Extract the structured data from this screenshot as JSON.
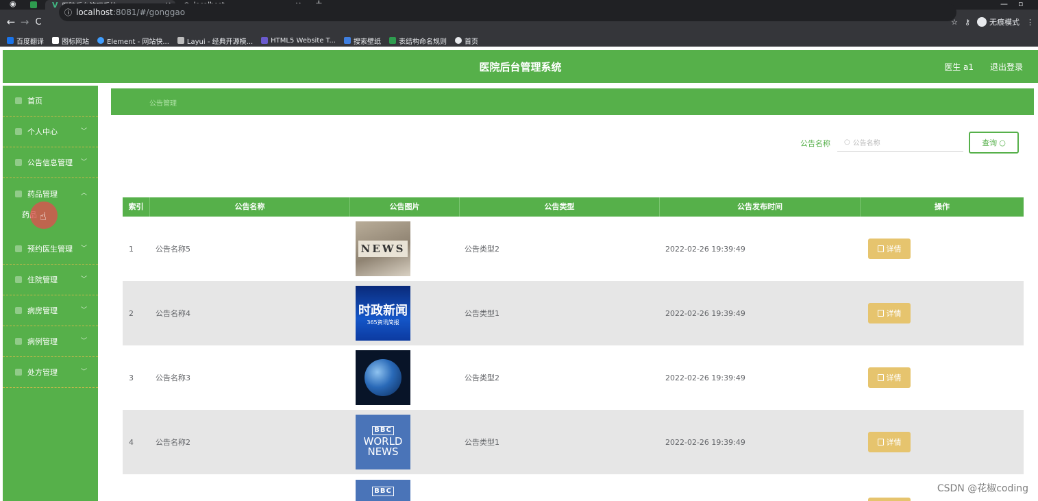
{
  "browser": {
    "tabs": [
      {
        "title": "医院后台管理系统",
        "active": true
      },
      {
        "title": "localhost",
        "active": false
      }
    ],
    "url_host": "localhost",
    "url_rest": ":8081/#/gonggao",
    "incognito_label": "无痕模式",
    "bookmarks": [
      {
        "label": "百度翻译",
        "icon": "translate-icon",
        "color": "#1a73e8"
      },
      {
        "label": "图标网站",
        "icon": "flag-icon",
        "color": "#ffffff"
      },
      {
        "label": "Element - 网站快...",
        "icon": "element-icon",
        "color": "#409eff"
      },
      {
        "label": "Layui - 经典开源模...",
        "icon": "layui-icon",
        "color": "#bdbdbd"
      },
      {
        "label": "HTML5 Website T...",
        "icon": "html5-icon",
        "color": "#6a5acd"
      },
      {
        "label": "搜索壁纸",
        "icon": "wallpaper-icon",
        "color": "#3f7fe0"
      },
      {
        "label": "表结构命名规则",
        "icon": "doc-icon",
        "color": "#2e9c4f"
      },
      {
        "label": "首页",
        "icon": "globe-icon",
        "color": "#e8eaed"
      }
    ]
  },
  "header": {
    "title": "医院后台管理系统",
    "user": "医生 a1",
    "logout": "退出登录"
  },
  "sidebar": {
    "items": [
      {
        "label": "首页",
        "has_chevron": false
      },
      {
        "label": "个人中心",
        "has_chevron": true
      },
      {
        "label": "公告信息管理",
        "has_chevron": true
      },
      {
        "label": "药品管理",
        "has_chevron": true,
        "expanded": true
      },
      {
        "label": "预约医生管理",
        "has_chevron": true
      },
      {
        "label": "住院管理",
        "has_chevron": true
      },
      {
        "label": "病房管理",
        "has_chevron": true
      },
      {
        "label": "病例管理",
        "has_chevron": true
      },
      {
        "label": "处方管理",
        "has_chevron": true
      }
    ],
    "submenu_label": "药品"
  },
  "breadcrumb": {
    "text": "公告管理"
  },
  "search": {
    "label": "公告名称",
    "placeholder": "公告名称",
    "button": "查询"
  },
  "table": {
    "headers": [
      "索引",
      "公告名称",
      "公告图片",
      "公告类型",
      "公告发布时间",
      "操作"
    ],
    "rows": [
      {
        "index": "1",
        "name": "公告名称5",
        "image": "news-blocks",
        "type": "公告类型2",
        "time": "2022-02-26 19:39:49",
        "action": "详情"
      },
      {
        "index": "2",
        "name": "公告名称4",
        "image": "shizheng",
        "type": "公告类型1",
        "time": "2022-02-26 19:39:49",
        "action": "详情"
      },
      {
        "index": "3",
        "name": "公告名称3",
        "image": "globe",
        "type": "公告类型2",
        "time": "2022-02-26 19:39:49",
        "action": "详情"
      },
      {
        "index": "4",
        "name": "公告名称2",
        "image": "bbc",
        "type": "公告类型1",
        "time": "2022-02-26 19:39:49",
        "action": "详情"
      }
    ],
    "image_texts": {
      "news": "NEWS",
      "shizheng_main": "时政新闻",
      "shizheng_sub": "365资讯简报",
      "bbc_logo": "BBC",
      "bbc_world": "WORLD",
      "bbc_news": "NEWS"
    }
  },
  "watermark": "CSDN @花椒coding",
  "colors": {
    "primary": "#56b04a",
    "detail": "#e6c46e",
    "row_alt": "#e6e6e6"
  }
}
